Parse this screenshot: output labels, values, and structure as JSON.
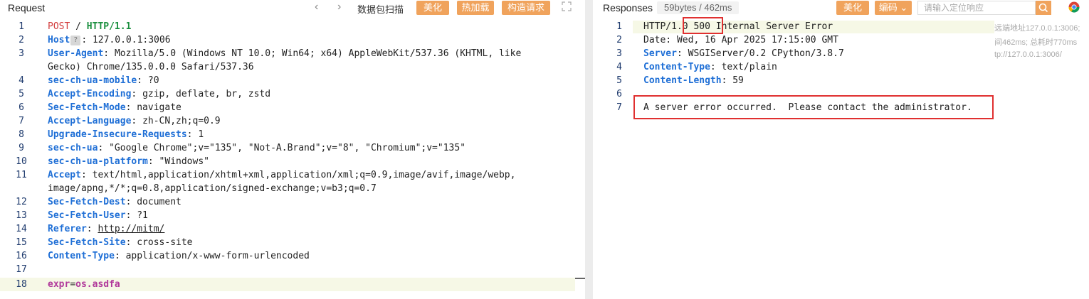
{
  "request": {
    "title": "Request",
    "nav_back": "‹",
    "nav_forward": "›",
    "scan_label": "数据包扫描",
    "buttons": {
      "beautify": "美化",
      "hot_load": "热加载",
      "construct": "构造请求"
    },
    "host_badge": "?",
    "lines": {
      "l1": {
        "n": "1",
        "method": "POST",
        "path": "/",
        "proto": "HTTP/1.1"
      },
      "l2": {
        "n": "2",
        "key": "Host",
        "val": "127.0.0.1:3006"
      },
      "l3": {
        "n": "3",
        "key": "User-Agent",
        "val": "Mozilla/5.0 (Windows NT 10.0; Win64; x64) AppleWebKit/537.36 (KHTML, like",
        "cont": "Gecko) Chrome/135.0.0.0 Safari/537.36"
      },
      "l4": {
        "n": "4",
        "key": "sec-ch-ua-mobile",
        "val": "?0"
      },
      "l5": {
        "n": "5",
        "key": "Accept-Encoding",
        "val": "gzip, deflate, br, zstd"
      },
      "l6": {
        "n": "6",
        "key": "Sec-Fetch-Mode",
        "val": "navigate"
      },
      "l7": {
        "n": "7",
        "key": "Accept-Language",
        "val": "zh-CN,zh;q=0.9"
      },
      "l8": {
        "n": "8",
        "key": "Upgrade-Insecure-Requests",
        "val": "1"
      },
      "l9": {
        "n": "9",
        "key": "sec-ch-ua",
        "val": "\"Google Chrome\";v=\"135\", \"Not-A.Brand\";v=\"8\", \"Chromium\";v=\"135\""
      },
      "l10": {
        "n": "10",
        "key": "sec-ch-ua-platform",
        "val": "\"Windows\""
      },
      "l11": {
        "n": "11",
        "key": "Accept",
        "val": "text/html,application/xhtml+xml,application/xml;q=0.9,image/avif,image/webp,",
        "cont": "image/apng,*/*;q=0.8,application/signed-exchange;v=b3;q=0.7"
      },
      "l12": {
        "n": "12",
        "key": "Sec-Fetch-Dest",
        "val": "document"
      },
      "l13": {
        "n": "13",
        "key": "Sec-Fetch-User",
        "val": "?1"
      },
      "l14": {
        "n": "14",
        "key": "Referer",
        "val": "http://mitm/"
      },
      "l15": {
        "n": "15",
        "key": "Sec-Fetch-Site",
        "val": "cross-site"
      },
      "l16": {
        "n": "16",
        "key": "Content-Type",
        "val": "application/x-www-form-urlencoded"
      },
      "l17": {
        "n": "17"
      },
      "l18": {
        "n": "18",
        "key": "expr",
        "val": "os.asdfa"
      }
    }
  },
  "response": {
    "title": "Responses",
    "stats": "59bytes / 462ms",
    "buttons": {
      "beautify": "美化",
      "encoding": "编码 ⌄"
    },
    "search_placeholder": "请输入定位响应",
    "lines": {
      "l1": {
        "n": "1",
        "proto": "HTTP/1.0",
        "code": "500",
        "reason": "Internal Server Error"
      },
      "l2": {
        "n": "2",
        "text": "Date: Wed, 16 Apr 2025 17:15:00 GMT"
      },
      "l3": {
        "n": "3",
        "key": "Server",
        "val": "WSGIServer/0.2 CPython/3.8.7"
      },
      "l4": {
        "n": "4",
        "key": "Content-Type",
        "val": "text/plain"
      },
      "l5": {
        "n": "5",
        "key": "Content-Length",
        "val": "59"
      },
      "l6": {
        "n": "6"
      },
      "l7": {
        "n": "7",
        "text": "A server error occurred.  Please contact the administrator."
      }
    },
    "side_info": {
      "remote": "远端地址127.0.0.1:3006;",
      "timing": "间462ms; 总耗时770ms",
      "url": "tp://127.0.0.1:3006/"
    }
  },
  "colors": {
    "accent_orange": "#f0a35c",
    "key_blue": "#1f6fd6",
    "highlight_box": "#e03030"
  }
}
